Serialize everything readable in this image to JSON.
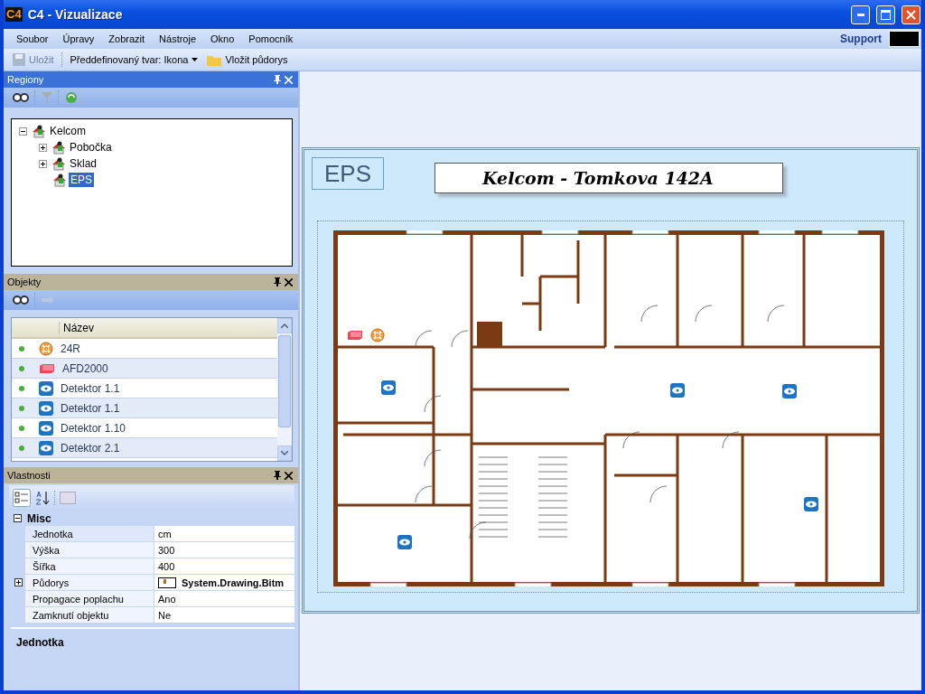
{
  "window": {
    "title": "C4 - Vizualizace",
    "logo": "C4"
  },
  "menu": [
    "Soubor",
    "Úpravy",
    "Zobrazit",
    "Nástroje",
    "Okno",
    "Pomocník"
  ],
  "support": {
    "label": "Support"
  },
  "toolbar": [
    {
      "kind": "button",
      "label": "Uložit",
      "disabled": true
    },
    {
      "kind": "dropdown",
      "label": "Předdefinovaný tvar: Ikona",
      "disabled": false
    },
    {
      "kind": "button",
      "label": "Vložit půdorys",
      "disabled": false
    }
  ],
  "regions": {
    "title": "Regiony",
    "tree": [
      {
        "label": "Kelcom",
        "expanded": true,
        "selected": false,
        "children": [
          {
            "label": "Pobočka",
            "expanded": false,
            "selected": false
          },
          {
            "label": "Sklad",
            "expanded": false,
            "selected": false
          },
          {
            "label": "EPS",
            "selected": true
          }
        ]
      }
    ]
  },
  "objects": {
    "title": "Objekty",
    "columns": [
      "Název"
    ],
    "rows": [
      {
        "kind": "sounder",
        "name": "24R",
        "color": "#4caf3c"
      },
      {
        "kind": "panel",
        "name": "AFD2000",
        "color": "#4caf3c"
      },
      {
        "kind": "detector",
        "name": "Detektor 1.1",
        "color": "#4caf3c"
      },
      {
        "kind": "detector",
        "name": "Detektor 1.1",
        "color": "#4caf3c"
      },
      {
        "kind": "detector",
        "name": "Detektor 1.10",
        "color": "#4caf3c"
      },
      {
        "kind": "detector",
        "name": "Detektor 2.1",
        "color": "#4caf3c"
      }
    ]
  },
  "properties": {
    "title": "Vlastnosti",
    "category": {
      "label": "Misc",
      "expanded": true
    },
    "rows": [
      {
        "name": "Jednotka",
        "value": "cm",
        "selected": true
      },
      {
        "name": "Výška",
        "value": "300",
        "selected": false
      },
      {
        "name": "Šířka",
        "value": "400",
        "selected": false
      },
      {
        "name": "Půdorys",
        "value": "System.Drawing.Bitm",
        "expandable": true,
        "kind": "image",
        "selected": false
      },
      {
        "name": "Propagace poplachu",
        "value": "Ano",
        "selected": false
      },
      {
        "name": "Zamknutí objektu",
        "value": "Ne",
        "selected": false
      }
    ],
    "description": "Jednotka"
  },
  "canvas": {
    "label": "EPS",
    "heading": "Kelcom - Tomkova 142A"
  }
}
